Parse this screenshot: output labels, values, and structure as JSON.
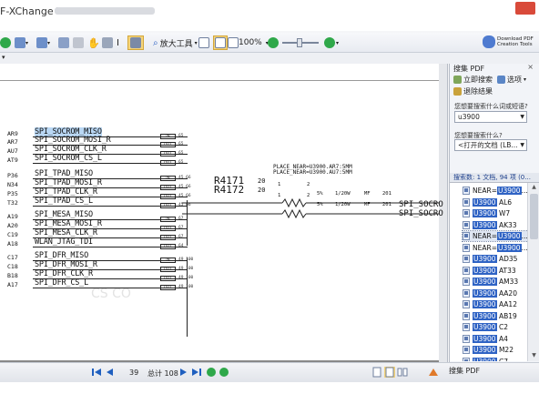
{
  "window": {
    "title": "F-XChange Viewer"
  },
  "toolbar": {
    "zoom_tool_label": "放大工具",
    "zoom_level": "100%",
    "download_label_1": "Download PDF",
    "download_label_2": "Creation Tools"
  },
  "schematic": {
    "rows": [
      {
        "pin": "AR9",
        "net": "SPI_SOCROM_MISO",
        "dir": "IN",
        "page": "65"
      },
      {
        "pin": "AR7",
        "net": "SPI_SOCROM_MOSI_R",
        "dir": "OUT",
        "page": "65"
      },
      {
        "pin": "AU7",
        "net": "SPI_SOCROM_CLK_R",
        "dir": "OUT",
        "page": "65"
      },
      {
        "pin": "AT9",
        "net": "SPI_SOCROM_CS_L",
        "dir": "OUT",
        "page": "65"
      },
      {
        "pin": "P36",
        "net": "SPI_TPAD_MISO",
        "dir": "IN",
        "page": "45 66"
      },
      {
        "pin": "N34",
        "net": "SPI_TPAD_MOSI_R",
        "dir": "OUT",
        "page": "45 66"
      },
      {
        "pin": "P35",
        "net": "SPI_TPAD_CLK_R",
        "dir": "OUT",
        "page": "45 66"
      },
      {
        "pin": "T32",
        "net": "SPI_TPAD_CS_L",
        "dir": "OUT",
        "page": "45 66"
      },
      {
        "pin": "A19",
        "net": "SPI_MESA_MISO",
        "dir": "IN",
        "page": "67"
      },
      {
        "pin": "A20",
        "net": "SPI_MESA_MOSI_R",
        "dir": "OUT",
        "page": "67"
      },
      {
        "pin": "C19",
        "net": "SPI_MESA_CLK_R",
        "dir": "OUT",
        "page": "67"
      },
      {
        "pin": "A18",
        "net": "WLAN_JTAG_TDI",
        "dir": "OUT",
        "page": "64"
      },
      {
        "pin": "C17",
        "net": "SPI_DFR_MISO",
        "dir": "IN",
        "page": "49 100"
      },
      {
        "pin": "C18",
        "net": "SPI_DFR_MOSI_R",
        "dir": "OUT",
        "page": "49 100"
      },
      {
        "pin": "B18",
        "net": "SPI_DFR_CLK_R",
        "dir": "OUT",
        "page": "49 100"
      },
      {
        "pin": "A17",
        "net": "SPI_DFR_CS_L",
        "dir": "OUT",
        "page": "49 100"
      }
    ],
    "resistors": [
      {
        "ref": "R4171",
        "value": "20",
        "pin1": "1",
        "pin2": "2",
        "tol": "5%",
        "power": "1/20W",
        "type": "MF",
        "size": "201",
        "net_out": "SPI_SOCRO"
      },
      {
        "ref": "R4172",
        "value": "20",
        "pin1": "1",
        "pin2": "2",
        "tol": "5%",
        "power": "1/20W",
        "type": "MF",
        "size": "201",
        "net_out": "SPI_SOCRO"
      }
    ],
    "place_note_1": "PLACE_NEAR=U3900.AR7:5MM",
    "place_note_2": "PLACE_NEAR=U3900.AU7:5MM",
    "watermark": "CS CO"
  },
  "status": {
    "current_page": "39",
    "total_pages": "总计 108"
  },
  "search_panel": {
    "title": "搜集 PDF",
    "instant_search": "立即搜索",
    "options": "选项",
    "exit_results": "退除结果",
    "what_label": "您想要搜索什么词或短语?",
    "query": "u3900",
    "where_label": "您想要搜索什么?",
    "scope": "<打开的文档 (LB...",
    "results_summary": "搜索数: 1 文档, 94 项 (0...",
    "results": [
      {
        "prefix": "NEAR=",
        "match": "U3900",
        "suffix": "..."
      },
      {
        "prefix": "",
        "match": "U3900",
        "suffix": " AL6"
      },
      {
        "prefix": "",
        "match": "U3900",
        "suffix": " W7"
      },
      {
        "prefix": "",
        "match": "U3900",
        "suffix": " AK33"
      },
      {
        "prefix": "NEAR=",
        "match": "U3900",
        "suffix": "..."
      },
      {
        "prefix": "NEAR=",
        "match": "U3900",
        "suffix": "..."
      },
      {
        "prefix": "",
        "match": "U3900",
        "suffix": " AD35"
      },
      {
        "prefix": "",
        "match": "U3900",
        "suffix": " AT33"
      },
      {
        "prefix": "",
        "match": "U3900",
        "suffix": " AM33"
      },
      {
        "prefix": "",
        "match": "U3900",
        "suffix": " AA20"
      },
      {
        "prefix": "",
        "match": "U3900",
        "suffix": " AA12"
      },
      {
        "prefix": "",
        "match": "U3900",
        "suffix": " AB19"
      },
      {
        "prefix": "",
        "match": "U3900",
        "suffix": " C2"
      },
      {
        "prefix": "",
        "match": "U3900",
        "suffix": " A4"
      },
      {
        "prefix": "",
        "match": "U3900",
        "suffix": " M22"
      },
      {
        "prefix": "",
        "match": "U3900",
        "suffix": " C7"
      }
    ],
    "bottom_tab": "搜集 PDF"
  },
  "colors": {
    "accent": "#2f63c4",
    "nav_blue": "#1f5fbf",
    "go_green": "#2fa84a"
  }
}
